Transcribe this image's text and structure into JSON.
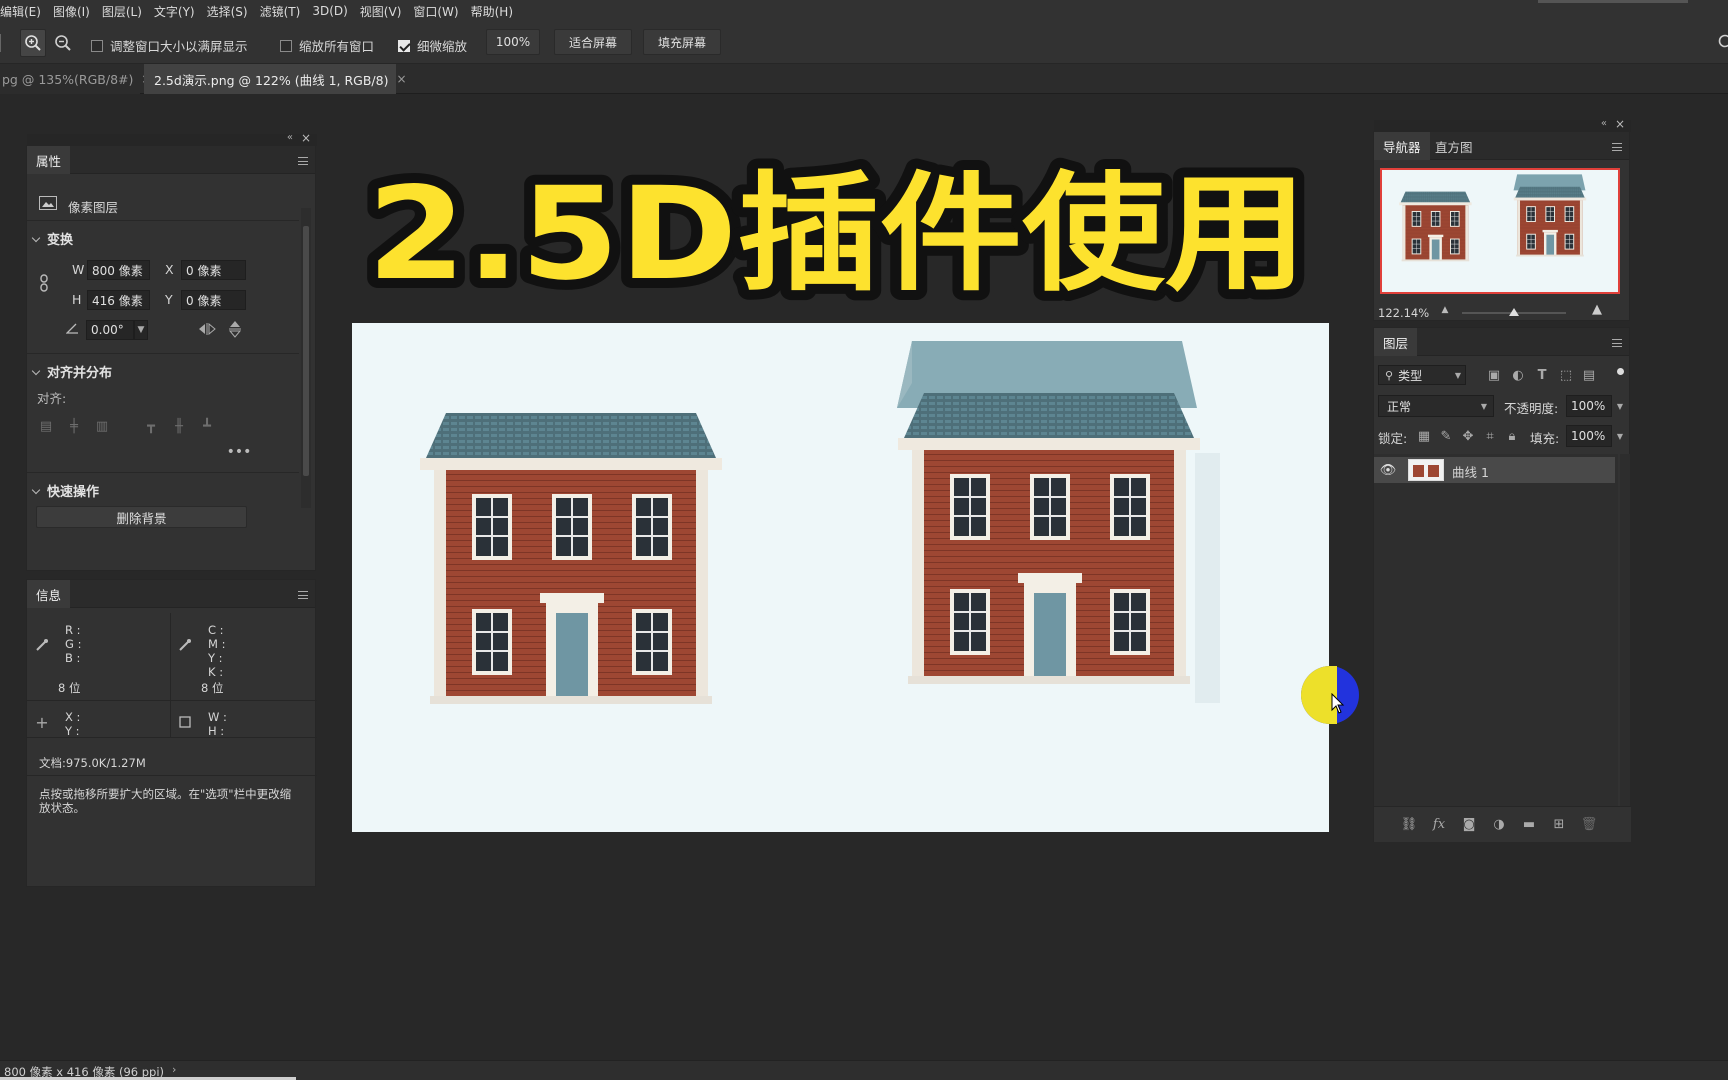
{
  "menu": [
    "编辑(E)",
    "图像(I)",
    "图层(L)",
    "文字(Y)",
    "选择(S)",
    "滤镜(T)",
    "3D(D)",
    "视图(V)",
    "窗口(W)",
    "帮助(H)"
  ],
  "options": {
    "resize_windows": "调整窗口大小以满屏显示",
    "zoom_all": "缩放所有窗口",
    "scrubby_zoom": "细微缩放",
    "zoom_value": "100%",
    "fit_screen": "适合屏幕",
    "fill_screen": "填充屏幕"
  },
  "tabs": [
    {
      "label": "pg @ 135%(RGB/8#)",
      "active": false
    },
    {
      "label": "2.5d演示.png @ 122% (曲线 1, RGB/8)",
      "active": true
    }
  ],
  "properties": {
    "tab": "属性",
    "layer_type": "像素图层",
    "transform_title": "变换",
    "w_label": "W",
    "w": "800 像素",
    "x_label": "X",
    "x": "0 像素",
    "h_label": "H",
    "h": "416 像素",
    "y_label": "Y",
    "y": "0 像素",
    "angle": "0.00°",
    "align_title": "对齐并分布",
    "align_label": "对齐:",
    "quick_title": "快速操作",
    "remove_bg": "删除背景"
  },
  "info": {
    "tab": "信息",
    "r": "R :",
    "g": "G :",
    "b": "B :",
    "bit1": "8 位",
    "c": "C :",
    "m": "M :",
    "yy": "Y :",
    "k": "K :",
    "bit2": "8 位",
    "xl": "X :",
    "yl": "Y :",
    "wl": "W :",
    "hl": "H :",
    "doc": "文档:975.0K/1.27M",
    "hint": "点按或拖移所要扩大的区域。在\"选项\"栏中更改缩放状态。"
  },
  "navigator": {
    "tab_nav": "导航器",
    "tab_hist": "直方图",
    "zoom": "122.14%",
    "slider_fraction": 0.5
  },
  "layers": {
    "tab": "图层",
    "filter": "类型",
    "blend": "正常",
    "opacity_label": "不透明度:",
    "opacity": "100%",
    "lock_label": "锁定:",
    "fill_label": "填充:",
    "fill": "100%",
    "layer_name": "曲线 1"
  },
  "canvas": {
    "headline": "2.5D插件使用",
    "headline_color": "#fde22e",
    "bg_color": "#eef7f9"
  },
  "status": "800 像素 x 416 像素 (96 ppi)"
}
